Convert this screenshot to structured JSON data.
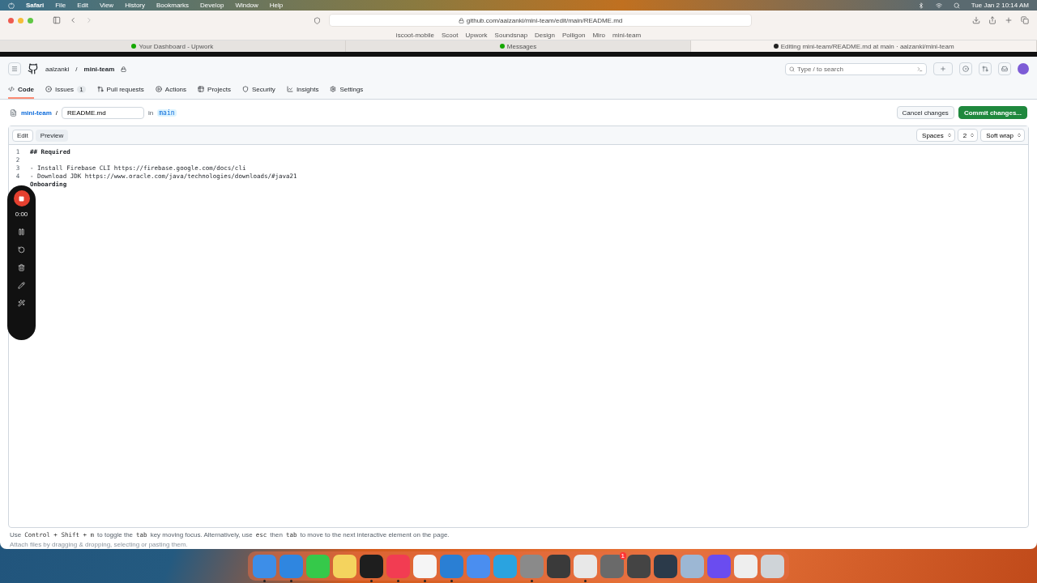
{
  "menu_bar": {
    "app": "Safari",
    "items": [
      "File",
      "Edit",
      "View",
      "History",
      "Bookmarks",
      "Develop",
      "Window",
      "Help"
    ],
    "clock": "Tue Jan 2  10:14 AM"
  },
  "browser": {
    "address": "github.com/aalzanki/mini-team/edit/main/README.md",
    "favorites": [
      "iscoot-mobile",
      "Scoot",
      "Upwork",
      "Soundsnap",
      "Design",
      "Polligon",
      "Miro",
      "mini-team"
    ],
    "tabs": [
      {
        "title": "Your Dashboard - Upwork",
        "selected": false
      },
      {
        "title": "Messages",
        "selected": false
      },
      {
        "title": "Editing mini-team/README.md at main · aalzanki/mini-team",
        "selected": true
      }
    ]
  },
  "repo_header": {
    "owner": "aalzanki",
    "separator": "/",
    "repo": "mini-team",
    "search_placeholder": "Type / to search"
  },
  "repo_nav": [
    {
      "label": "Code",
      "selected": true
    },
    {
      "label": "Issues",
      "selected": false,
      "count": "1"
    },
    {
      "label": "Pull requests",
      "selected": false
    },
    {
      "label": "Actions",
      "selected": false
    },
    {
      "label": "Projects",
      "selected": false
    },
    {
      "label": "Security",
      "selected": false
    },
    {
      "label": "Insights",
      "selected": false
    },
    {
      "label": "Settings",
      "selected": false
    }
  ],
  "file_bar": {
    "repo": "mini-team",
    "separator": "/",
    "filename": "README.md",
    "in": "in",
    "branch": "main",
    "cancel": "Cancel changes",
    "commit": "Commit changes..."
  },
  "editor_toolbar": {
    "tabs": [
      {
        "label": "Edit",
        "selected": true
      },
      {
        "label": "Preview",
        "selected": false
      }
    ],
    "indent_mode": "Spaces",
    "indent_size": "2",
    "wrap_mode": "Soft wrap"
  },
  "editor_lines": [
    {
      "number": "1",
      "text": "## Required",
      "bold": true
    },
    {
      "number": "2"
    },
    {
      "number": "3",
      "text": "- Install Firebase CLI https://firebase.google.com/docs/cli",
      "bold": false
    },
    {
      "number": "4",
      "text": "- Download JDK https://www.oracle.com/java/technologies/downloads/#java21",
      "bold": false
    },
    {
      "text": "Onboarding",
      "bold": true
    }
  ],
  "recorder": {
    "time": "0:00"
  },
  "footer": {
    "hint_parts": [
      {
        "kind": "text",
        "text": "Use"
      },
      {
        "kind": "key",
        "text": "Control + Shift + m"
      },
      {
        "kind": "text",
        "text": "to toggle the"
      },
      {
        "kind": "key",
        "text": "tab"
      },
      {
        "kind": "text",
        "text": "key moving focus. Alternatively, use"
      },
      {
        "kind": "key",
        "text": "esc"
      },
      {
        "kind": "text",
        "text": "then"
      },
      {
        "kind": "key",
        "text": "tab"
      },
      {
        "kind": "text",
        "text": "to move to the next interactive element on the page."
      }
    ],
    "attach": "Attach files by dragging & dropping, selecting or pasting them."
  },
  "dock": [
    {
      "color": "#3d8ee8",
      "running": true
    },
    {
      "color": "#2f86e0",
      "running": true
    },
    {
      "color": "#35c94a",
      "running": false
    },
    {
      "color": "#f4d35e",
      "running": false
    },
    {
      "color": "#1e1e1e",
      "running": true
    },
    {
      "color": "#f23c52",
      "running": true
    },
    {
      "color": "#f5f5f5",
      "running": true
    },
    {
      "color": "#2a7fd4",
      "running": true
    },
    {
      "color": "#4a8ef0",
      "running": false
    },
    {
      "color": "#2aa3e0",
      "running": false
    },
    {
      "color": "#8a8a8a",
      "running": true
    },
    {
      "color": "#3a3a3a",
      "running": false
    },
    {
      "color": "#e8e8e8",
      "running": true
    },
    {
      "color": "#6a6a6a",
      "running": false,
      "badge": "1"
    },
    {
      "color": "#444444",
      "running": false
    },
    {
      "color": "#2b3a4a",
      "running": false
    },
    {
      "color": "#9cb7d4",
      "running": false
    },
    {
      "color": "#6a4cf0",
      "running": false
    },
    {
      "color": "#eeeeee",
      "running": false
    },
    {
      "color": "#cfd4d8",
      "running": false
    }
  ]
}
